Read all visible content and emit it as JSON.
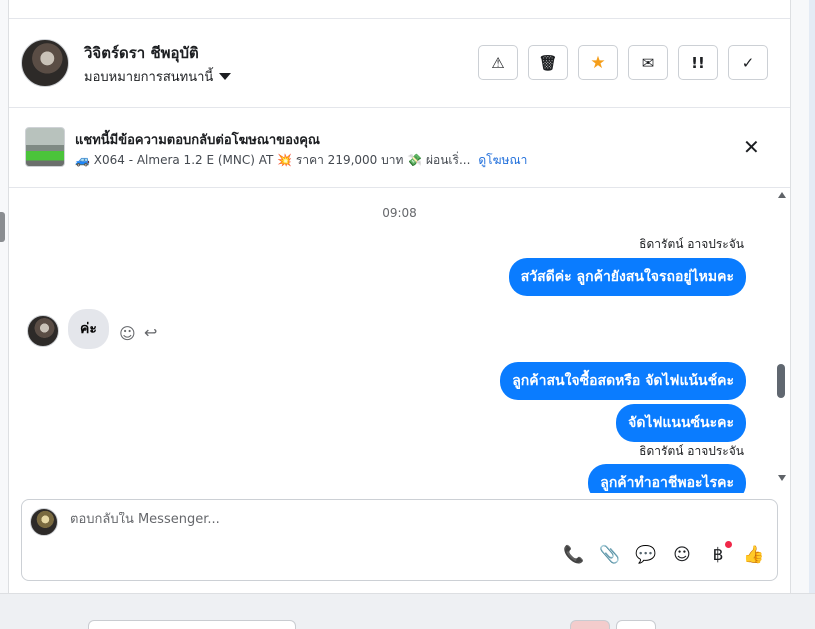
{
  "header": {
    "contact_name": "วิจิตร์ดรา ชีพอุบัติ",
    "assign_label": "มอบหมายการสนทนานี้",
    "actions": [
      {
        "name": "report-spam-button",
        "icon": "warning-icon",
        "glyph": "⚠"
      },
      {
        "name": "delete-button",
        "icon": "trash-icon",
        "glyph": "🗑"
      },
      {
        "name": "star-button",
        "icon": "star-icon",
        "glyph": "★"
      },
      {
        "name": "mark-unread-button",
        "icon": "envelope-icon",
        "glyph": "✉"
      },
      {
        "name": "follow-up-button",
        "icon": "exclamation-icon",
        "glyph": "!!"
      },
      {
        "name": "mark-done-button",
        "icon": "check-icon",
        "glyph": "✓"
      }
    ]
  },
  "banner": {
    "title": "แชทนี้มีข้อความตอบกลับต่อโฆษณาของคุณ",
    "subtitle": "🚙 X064 - Almera 1.2 E (MNC) AT 💥 ราคา 219,000 บาท 💸 ผ่อนเริ่...",
    "link": "ดูโฆษณา",
    "close_glyph": "✕"
  },
  "messages": {
    "time": "09:08",
    "sender_1": "ธิดารัตน์ อาจประจัน",
    "out_1": "สวัสดีค่ะ ลูกค้ายังสนใจรถอยู่ไหมคะ",
    "in_1": "ค่ะ",
    "out_2": "ลูกค้าสนใจซื้อสดหรือ จัดไฟแน้นช์คะ",
    "out_3": "จัดไฟแนนซ์นะคะ",
    "sender_2": "ธิดารัตน์ อาจประจัน",
    "out_4": "ลูกค้าทำอาชีพอะไรคะ"
  },
  "composer": {
    "placeholder": "ตอบกลับใน Messenger...",
    "tools": [
      {
        "name": "call-button",
        "icon": "phone-plus-icon",
        "glyph": "📞"
      },
      {
        "name": "attach-button",
        "icon": "paperclip-icon",
        "glyph": "📎"
      },
      {
        "name": "saved-replies-button",
        "icon": "chat-bubble-icon",
        "glyph": "💬"
      },
      {
        "name": "emoji-button",
        "icon": "smiley-icon",
        "glyph": "☺"
      },
      {
        "name": "payment-button",
        "icon": "baht-icon",
        "glyph": "฿"
      },
      {
        "name": "like-button",
        "icon": "thumbs-up-icon",
        "glyph": "👍"
      }
    ]
  },
  "colors": {
    "outgoing_bubble": "#0a7cff",
    "incoming_bubble": "#e4e6eb",
    "link": "#216fdb",
    "star": "#f59e1b",
    "notification_dot": "#f02849"
  }
}
